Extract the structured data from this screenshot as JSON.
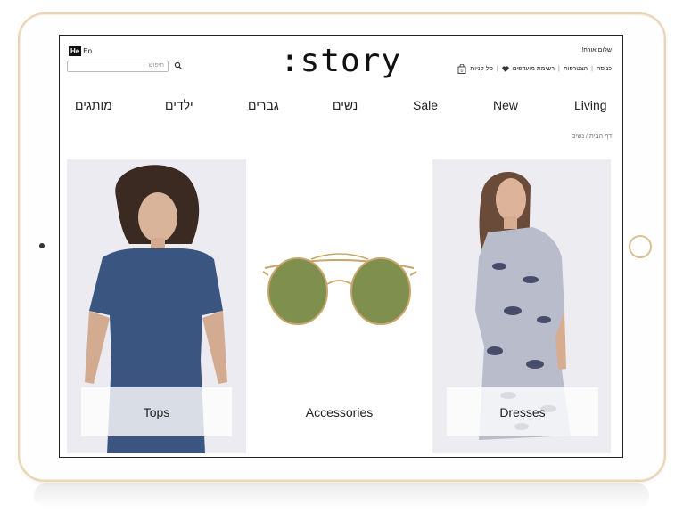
{
  "header": {
    "lang_active": "He",
    "lang_other": "En",
    "search_placeholder": "חיפוש",
    "logo": ":story",
    "greeting": "שלום אורח!",
    "links": [
      "כניסה",
      "הצטרפות",
      "רשימת מועדפים",
      "סל קניות"
    ]
  },
  "nav": [
    "מותגים",
    "ילדים",
    "גברים",
    "נשים",
    "Sale",
    "New",
    "Living"
  ],
  "breadcrumb": "דף הבית / נשים",
  "tiles": [
    {
      "label": "Tops"
    },
    {
      "label": "Accessories"
    },
    {
      "label": "Dresses"
    }
  ],
  "colors": {
    "frame": "#e9d4b4",
    "text": "#222222",
    "sunglass_lens": "#7e8f4e"
  },
  "icons": [
    "search-icon",
    "heart-icon",
    "shopping-bag-icon"
  ]
}
